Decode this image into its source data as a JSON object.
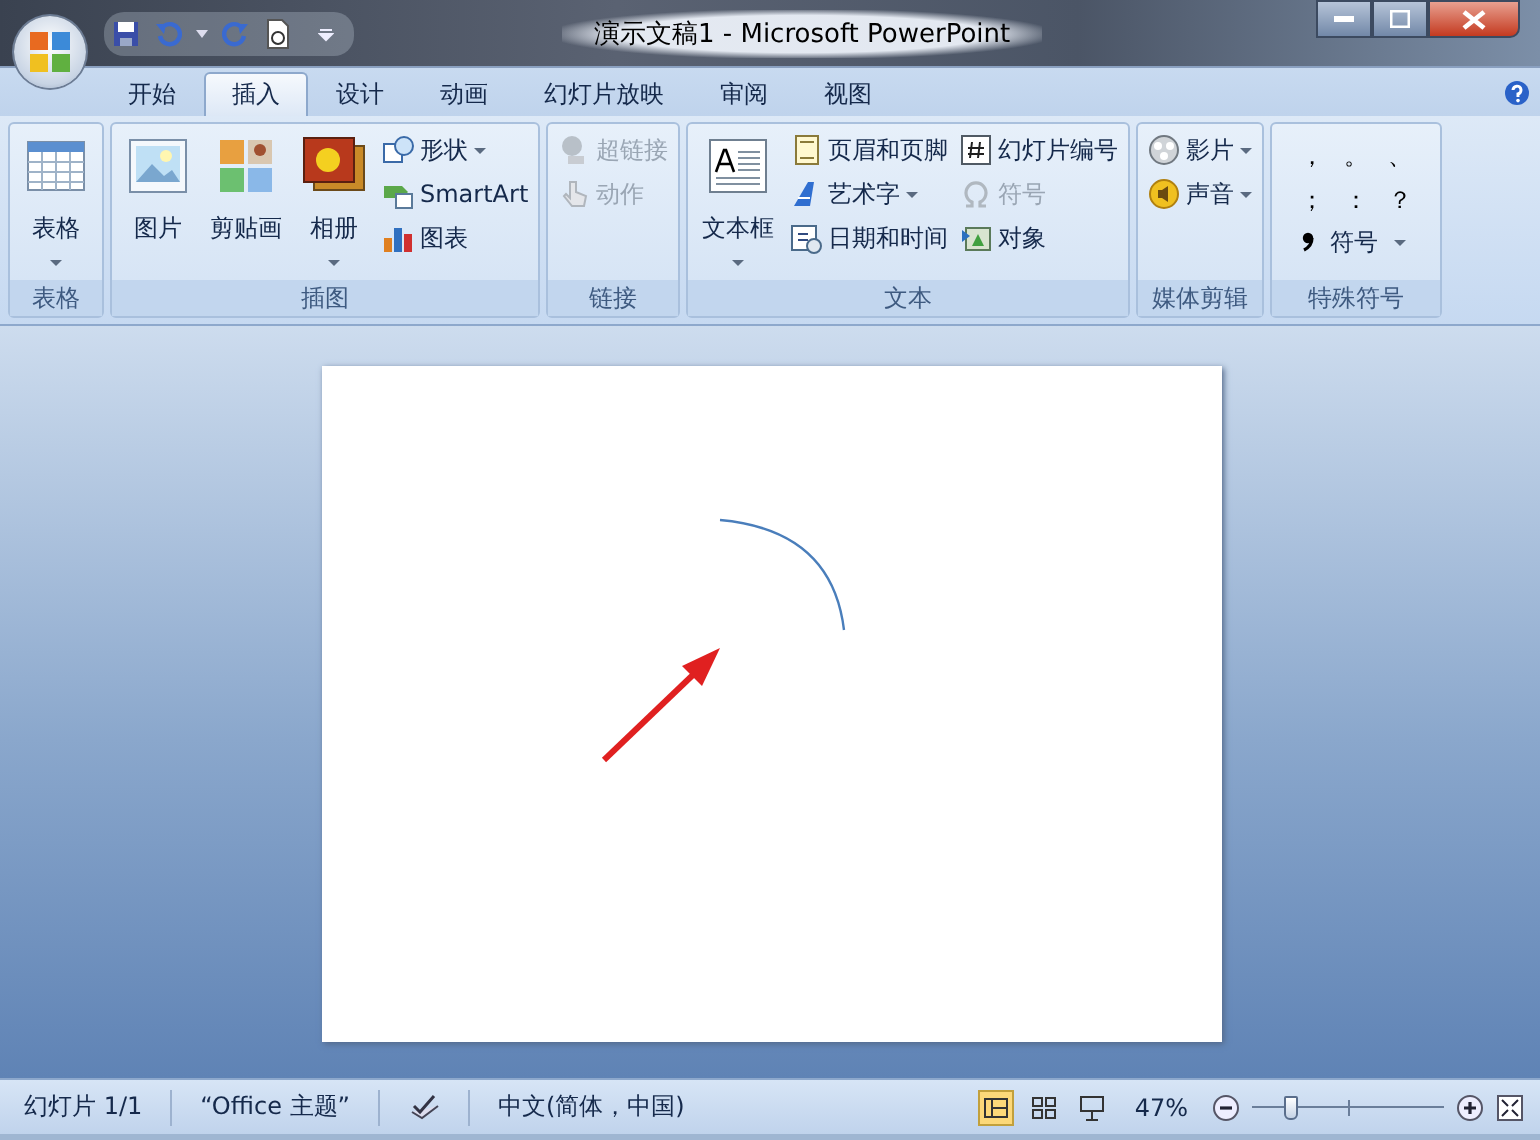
{
  "window": {
    "title": "演示文稿1 - Microsoft PowerPoint"
  },
  "tabs": [
    {
      "label": "开始",
      "selected": false
    },
    {
      "label": "插入",
      "selected": true
    },
    {
      "label": "设计",
      "selected": false
    },
    {
      "label": "动画",
      "selected": false
    },
    {
      "label": "幻灯片放映",
      "selected": false
    },
    {
      "label": "审阅",
      "selected": false
    },
    {
      "label": "视图",
      "selected": false
    }
  ],
  "ribbon_groups": [
    {
      "name": "表格",
      "items": [
        {
          "kind": "large",
          "label": "表格",
          "has_dropdown": true,
          "disabled": false
        }
      ]
    },
    {
      "name": "插图",
      "items": [
        {
          "kind": "large",
          "label": "图片",
          "has_dropdown": false,
          "disabled": false
        },
        {
          "kind": "large",
          "label": "剪贴画",
          "has_dropdown": false,
          "disabled": false
        },
        {
          "kind": "large",
          "label": "相册",
          "has_dropdown": true,
          "disabled": false
        },
        {
          "kind": "small",
          "label": "形状",
          "has_dropdown": true,
          "disabled": false
        },
        {
          "kind": "small",
          "label": "SmartArt",
          "has_dropdown": false,
          "disabled": false
        },
        {
          "kind": "small",
          "label": "图表",
          "has_dropdown": false,
          "disabled": false
        }
      ]
    },
    {
      "name": "链接",
      "items": [
        {
          "kind": "small",
          "label": "超链接",
          "has_dropdown": false,
          "disabled": true
        },
        {
          "kind": "small",
          "label": "动作",
          "has_dropdown": false,
          "disabled": true
        }
      ]
    },
    {
      "name": "文本",
      "items": [
        {
          "kind": "large",
          "label": "文本框",
          "has_dropdown": true,
          "disabled": false
        },
        {
          "kind": "small",
          "label": "页眉和页脚",
          "has_dropdown": false,
          "disabled": false
        },
        {
          "kind": "small",
          "label": "艺术字",
          "has_dropdown": true,
          "disabled": false
        },
        {
          "kind": "small",
          "label": "日期和时间",
          "has_dropdown": false,
          "disabled": false
        },
        {
          "kind": "small",
          "label": "幻灯片编号",
          "has_dropdown": false,
          "disabled": false
        },
        {
          "kind": "small",
          "label": "符号",
          "has_dropdown": false,
          "disabled": true
        },
        {
          "kind": "small",
          "label": "对象",
          "has_dropdown": false,
          "disabled": false
        }
      ]
    },
    {
      "name": "媒体剪辑",
      "items": [
        {
          "kind": "small",
          "label": "影片",
          "has_dropdown": true,
          "disabled": false
        },
        {
          "kind": "small",
          "label": "声音",
          "has_dropdown": true,
          "disabled": false
        }
      ]
    },
    {
      "name": "特殊符号",
      "items": [
        {
          "kind": "symbol",
          "label": "，"
        },
        {
          "kind": "symbol",
          "label": "。"
        },
        {
          "kind": "symbol",
          "label": "、"
        },
        {
          "kind": "symbol",
          "label": "；"
        },
        {
          "kind": "symbol",
          "label": "："
        },
        {
          "kind": "symbol",
          "label": "？"
        },
        {
          "kind": "wide",
          "label": "符号",
          "has_dropdown": true,
          "disabled": false
        }
      ]
    }
  ],
  "status_bar": {
    "slide": "幻灯片 1/1",
    "theme": "“Office 主题”",
    "language": "中文(简体，中国)",
    "views": [
      {
        "selected": true
      },
      {
        "selected": false
      },
      {
        "selected": false
      }
    ],
    "zoom": "47%",
    "zoom_slider": {
      "level": 0.2
    }
  }
}
